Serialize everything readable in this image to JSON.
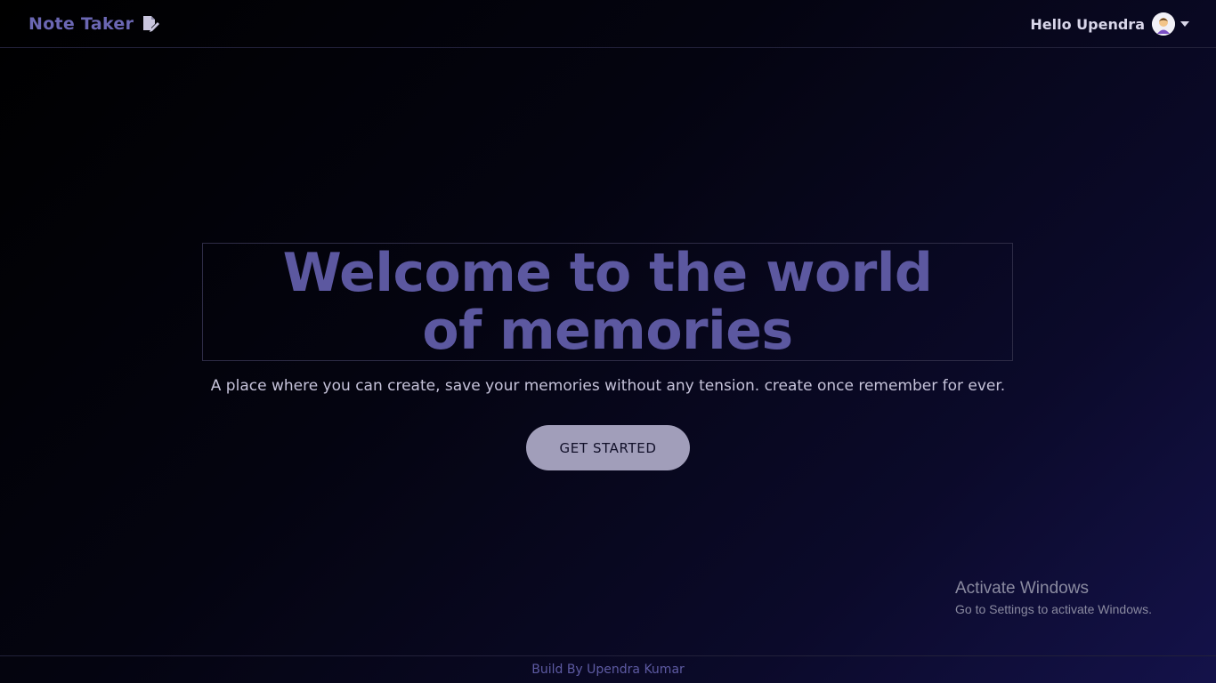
{
  "navbar": {
    "brand": "Note Taker",
    "brand_icon": "note-edit-icon",
    "greeting": "Hello Upendra",
    "avatar_icon": "user-avatar-icon",
    "dropdown_icon": "caret-down-icon"
  },
  "hero": {
    "title": "Welcome to the world of memories",
    "tagline": "A place where you can create, save your memories without any tension. create once remember for ever.",
    "cta_label": "GET STARTED"
  },
  "windows_watermark": {
    "title": "Activate Windows",
    "subtitle": "Go to Settings to activate Windows."
  },
  "footer": {
    "credit": "Build By Upendra Kumar"
  },
  "colors": {
    "accent": "#5c58a0",
    "button": "#a19eba",
    "background_dark": "#000000",
    "background_light": "#14124a"
  }
}
